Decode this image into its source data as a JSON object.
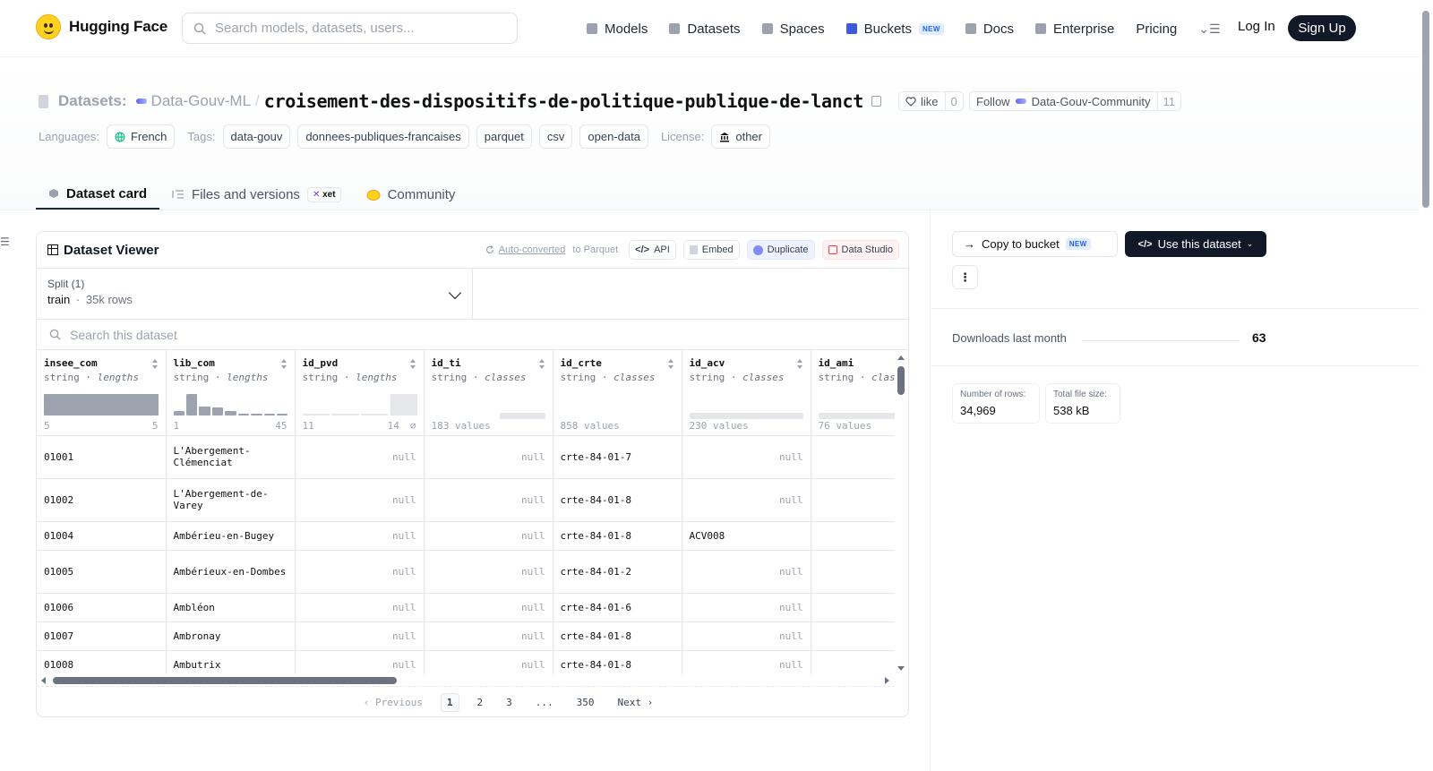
{
  "brand": {
    "name": "Hugging Face"
  },
  "search": {
    "placeholder": "Search models, datasets, users..."
  },
  "nav": {
    "items": [
      {
        "label": "Models",
        "icon": "cube-icon",
        "color": "#9ca3af"
      },
      {
        "label": "Datasets",
        "icon": "database-icon",
        "color": "#9ca3af"
      },
      {
        "label": "Spaces",
        "icon": "grid-icon",
        "color": "#9ca3af"
      },
      {
        "label": "Buckets",
        "icon": "bucket-icon",
        "color": "#3b5bdb",
        "badge": "NEW"
      },
      {
        "label": "Docs",
        "icon": "book-icon",
        "color": "#9ca3af"
      },
      {
        "label": "Enterprise",
        "icon": "enterprise-icon",
        "color": "#9ca3af"
      },
      {
        "label": "Pricing"
      }
    ],
    "menu_glyph": "⌄☰",
    "login": "Log In",
    "signup": "Sign Up"
  },
  "header": {
    "crumb_label": "Datasets:",
    "org": "Data-Gouv-ML",
    "separator": "/",
    "dataset_name": "croisement-des-dispositifs-de-politique-publique-de-lanct",
    "like_label": "like",
    "like_count": "0",
    "follow_label": "Follow",
    "follow_org": "Data-Gouv-Community",
    "follow_count": "11",
    "languages_key": "Languages:",
    "language": "French",
    "tags_key": "Tags:",
    "tags": [
      "data-gouv",
      "donnees-publiques-francaises",
      "parquet",
      "csv",
      "open-data"
    ],
    "license_key": "License:",
    "license": "other"
  },
  "tabs": [
    {
      "label": "Dataset card",
      "active": true
    },
    {
      "label": "Files and versions",
      "badge": "xet"
    },
    {
      "label": "Community"
    }
  ],
  "viewer": {
    "title": "Dataset Viewer",
    "auto_prefix": "Auto-converted",
    "auto_suffix": " to Parquet",
    "buttons": {
      "api": "API",
      "embed": "Embed",
      "duplicate": "Duplicate",
      "studio": "Data Studio"
    },
    "split_label": "Split (1)",
    "split_name": "train",
    "split_dot": "·",
    "split_rows": "35k rows",
    "search_placeholder": "Search this dataset",
    "columns": [
      {
        "name": "insee_com",
        "type": "string",
        "stat": "lengths",
        "kind": "hist",
        "min": "5",
        "max": "5",
        "bins": [
          1
        ]
      },
      {
        "name": "lib_com",
        "type": "string",
        "stat": "lengths",
        "kind": "hist",
        "min": "1",
        "max": "45",
        "bins": [
          0.18,
          1,
          0.4,
          0.35,
          0.2,
          0.08,
          0.06,
          0.05,
          0.04
        ]
      },
      {
        "name": "id_pvd",
        "type": "string",
        "stat": "lengths",
        "kind": "hist-null",
        "min": "11",
        "max": "14",
        "null_glyph": "∅",
        "bins": [
          0.04,
          0.04,
          0.04
        ]
      },
      {
        "name": "id_ti",
        "type": "string",
        "stat": "classes",
        "kind": "classes",
        "count_label": "183 values",
        "fill": 0.4
      },
      {
        "name": "id_crte",
        "type": "string",
        "stat": "classes",
        "kind": "classes",
        "count_label": "858 values",
        "fill": 0
      },
      {
        "name": "id_acv",
        "type": "string",
        "stat": "classes",
        "kind": "classes",
        "count_label": "230 values",
        "fill": 1
      },
      {
        "name": "id_ami",
        "type": "string",
        "stat": "classes",
        "kind": "classes",
        "count_label": "76 values",
        "fill": 1
      }
    ],
    "rows": [
      [
        "01001",
        "L'Abergement-Clémenciat",
        null,
        null,
        "crte-84-01-7",
        null,
        ""
      ],
      [
        "01002",
        "L'Abergement-de-Varey",
        null,
        null,
        "crte-84-01-8",
        null,
        ""
      ],
      [
        "01004",
        "Ambérieu-en-Bugey",
        null,
        null,
        "crte-84-01-8",
        "ACV008",
        ""
      ],
      [
        "01005",
        "Ambérieux-en-Dombes",
        null,
        null,
        "crte-84-01-2",
        null,
        ""
      ],
      [
        "01006",
        "Ambléon",
        null,
        null,
        "crte-84-01-6",
        null,
        ""
      ],
      [
        "01007",
        "Ambronay",
        null,
        null,
        "crte-84-01-8",
        null,
        ""
      ],
      [
        "01008",
        "Ambutrix",
        null,
        null,
        "crte-84-01-8",
        null,
        ""
      ]
    ],
    "null_text": "null",
    "pager": {
      "prev": "Previous",
      "next": "Next",
      "pages": [
        "1",
        "2",
        "3",
        "...",
        "350"
      ],
      "current": "1"
    }
  },
  "sidebar": {
    "copy_bucket": "Copy to bucket",
    "copy_badge": "NEW",
    "use_dataset": "Use this dataset",
    "more": "⋮",
    "downloads_label": "Downloads last month",
    "downloads_value": "63",
    "rows_label": "Number of rows:",
    "rows_value": "34,969",
    "size_label": "Total file size:",
    "size_value": "538 kB"
  }
}
